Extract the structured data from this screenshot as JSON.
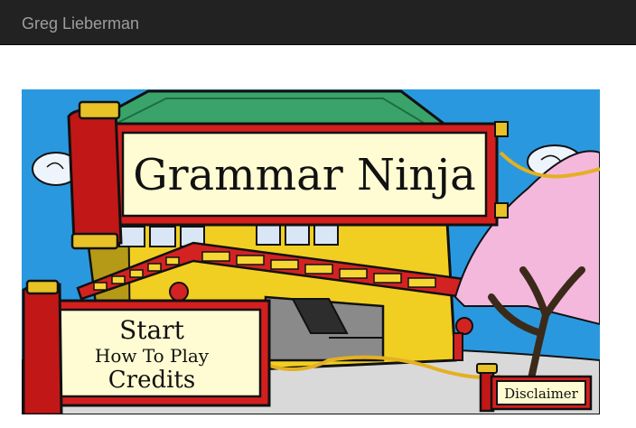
{
  "navbar": {
    "brand": "Greg Lieberman"
  },
  "game": {
    "title": "Grammar Ninja",
    "menu": {
      "start": "Start",
      "how_to_play": "How To Play",
      "credits": "Credits"
    },
    "disclaimer": "Disclaimer"
  }
}
